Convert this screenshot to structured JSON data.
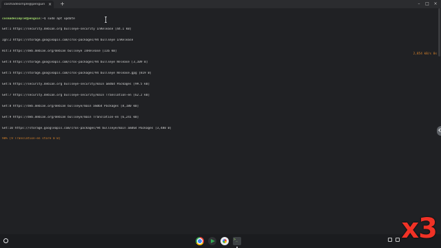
{
  "window": {
    "tab_title": "cosmadesimple@penguin",
    "tab_close_icon": "close-icon",
    "new_tab_label": "+",
    "controls": [
      "minimize-icon",
      "maximize-icon",
      "close-icon"
    ]
  },
  "terminal": {
    "prompt_user": "cosmadesimple@penguin",
    "prompt_rest": ":~$ sudo apt update",
    "lines": [
      "Get:1 https://security.debian.org bullseye-security InRelease [44.1 kB]",
      "Ign:2 https://storage.googleapis.com/cros-packages/94 bullseye InRelease",
      "Hit:3 https://deb.debian.org/debian bullseye InRelease [116 kB]",
      "Get:4 https://storage.googleapis.com/cros-packages/94 bullseye Release [3,109 B]",
      "Get:5 https://storage.googleapis.com/cros-packages/94 bullseye Release.gpg [819 B]",
      "Get:6 https://security.debian.org bullseye-security/main amd64 Packages [99.5 kB]",
      "Get:7 https://security.debian.org bullseye-security/main Translation-en [62.2 kB]",
      "Get:8 https://deb.debian.org/debian bullseye/main amd64 Packages [8,180 kB]",
      "Get:9 https://deb.debian.org/debian bullseye/main Translation-en [6,241 kB]",
      "Get:10 https://storage.googleapis.com/cros-packages/94 bullseye/main amd64 Packages [3,480 B]"
    ],
    "progress_text": "98% [9 Translation-en store 0 B]",
    "speed_text": "2,854 kB/s 0s"
  },
  "shelf": {
    "launcher_icon": "launcher-icon",
    "apps": [
      {
        "name": "chrome-icon"
      },
      {
        "name": "play-store-icon"
      },
      {
        "name": "photos-icon"
      },
      {
        "name": "terminal-icon"
      }
    ],
    "tray_icons": [
      "screen-capture-icon",
      "wifi-icon"
    ]
  },
  "overlay": {
    "speed_badge": "x3"
  },
  "colors": {
    "background": "#202124",
    "prompt_green": "#9fd56a",
    "progress_orange": "#d9832b",
    "badge_red": "#f03226"
  }
}
